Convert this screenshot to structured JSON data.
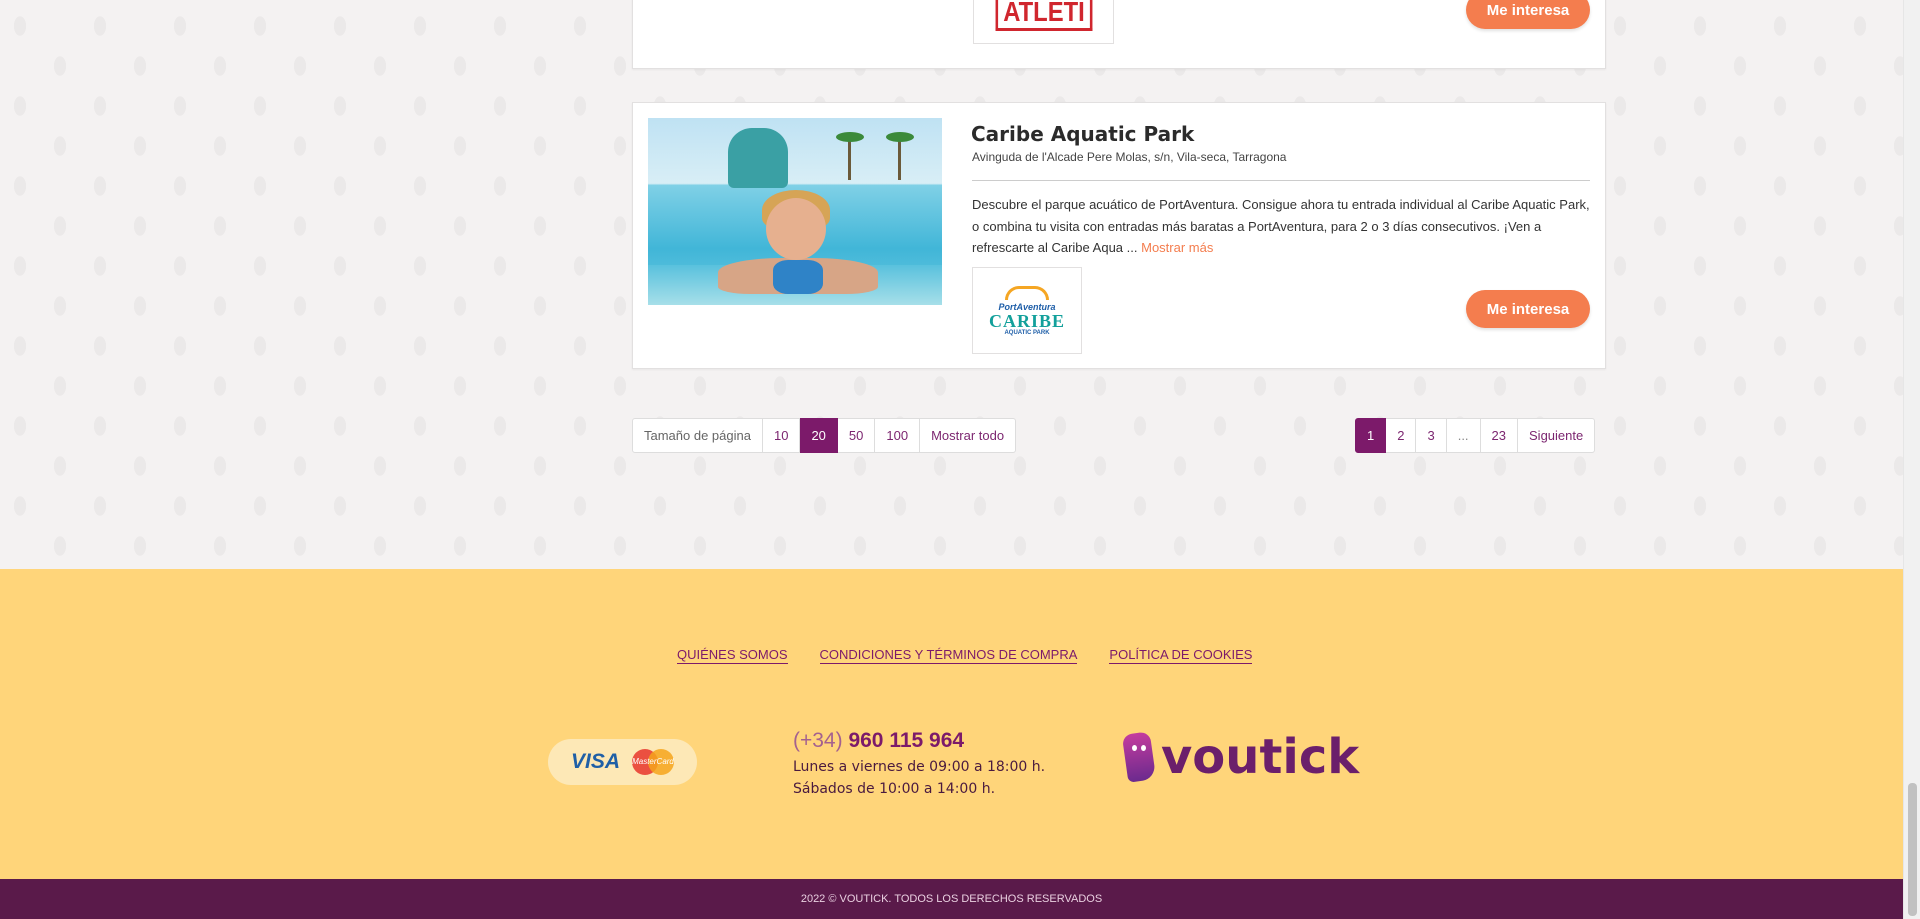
{
  "top_card": {
    "logo_text": "ATLETI",
    "button_label": "Me interesa"
  },
  "listing": {
    "title": "Caribe Aquatic Park",
    "address": "Avinguda de l'Alcade Pere Molas, s/n, Vila-seca, Tarragona",
    "description": "Descubre el parque acuático de PortAventura. Consigue ahora tu entrada individual al Caribe Aquatic Park, o combina tu visita con entradas más baratas a PortAventura, para 2 o 3 días consecutivos. ¡Ven a refrescarte al Caribe Aqua ...",
    "more_link": "Mostrar más",
    "button_label": "Me interesa",
    "logo": {
      "brand": "PortAventura",
      "word": "CARIBE",
      "sub": "AQUATIC PARK"
    }
  },
  "page_size": {
    "label": "Tamaño de página",
    "options": [
      "10",
      "20",
      "50",
      "100",
      "Mostrar todo"
    ],
    "selected": "20"
  },
  "pagination": {
    "pages": [
      "1",
      "2",
      "3",
      "...",
      "23"
    ],
    "current": "1",
    "next_label": "Siguiente"
  },
  "footer": {
    "links": [
      "QUIÉNES SOMOS",
      "CONDICIONES Y TÉRMINOS DE COMPRA",
      "POLÍTICA DE COOKIES"
    ],
    "payment": {
      "visa": "VISA",
      "mastercard": "MasterCard"
    },
    "phone_prefix": "(+34)",
    "phone_number": "960 115 964",
    "hours_weekdays": "Lunes a viernes de 09:00 a 18:00 h.",
    "hours_saturday": "Sábados de 10:00 a 14:00 h.",
    "brand": "voutick",
    "copyright": "2022 © VOUTICK. TODOS LOS DERECHOS RESERVADOS"
  },
  "colors": {
    "accent_orange": "#f47d4e",
    "brand_purple": "#7c1a6a",
    "footer_yellow": "#ffd57a",
    "bottom_bar": "#5a1a4a"
  }
}
